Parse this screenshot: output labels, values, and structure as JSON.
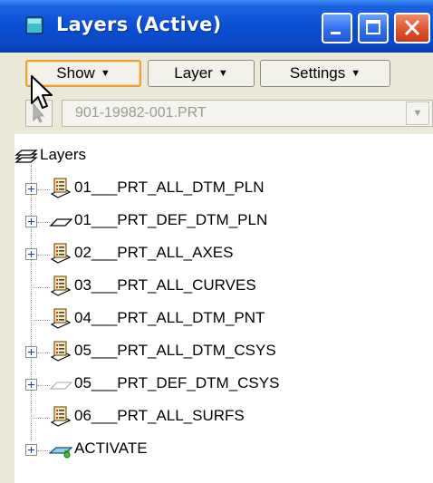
{
  "window": {
    "title": "Layers (Active)"
  },
  "toolbar": {
    "show_label": "Show",
    "layer_label": "Layer",
    "settings_label": "Settings"
  },
  "selector": {
    "value": "901-19982-001.PRT"
  },
  "tree": {
    "root_label": "Layers",
    "items": [
      {
        "label": "01___PRT_ALL_DTM_PLN",
        "icon": "layer-sheet-icon",
        "expandable": true
      },
      {
        "label": "01___PRT_DEF_DTM_PLN",
        "icon": "plane-icon",
        "expandable": true
      },
      {
        "label": "02___PRT_ALL_AXES",
        "icon": "layer-sheet-icon",
        "expandable": true
      },
      {
        "label": "03___PRT_ALL_CURVES",
        "icon": "layer-sheet-icon",
        "expandable": false
      },
      {
        "label": "04___PRT_ALL_DTM_PNT",
        "icon": "layer-sheet-icon",
        "expandable": false
      },
      {
        "label": "05___PRT_ALL_DTM_CSYS",
        "icon": "layer-sheet-icon",
        "expandable": true
      },
      {
        "label": "05___PRT_DEF_DTM_CSYS",
        "icon": "plane-faded-icon",
        "expandable": true
      },
      {
        "label": "06___PRT_ALL_SURFS",
        "icon": "layer-sheet-icon",
        "expandable": false
      },
      {
        "label": "ACTIVATE",
        "icon": "activate-layer-icon",
        "expandable": true
      }
    ]
  },
  "colors": {
    "title_bar": "#0a4fd4",
    "menu_active_border": "#e8a13a",
    "window_bg": "#ece9d8"
  }
}
